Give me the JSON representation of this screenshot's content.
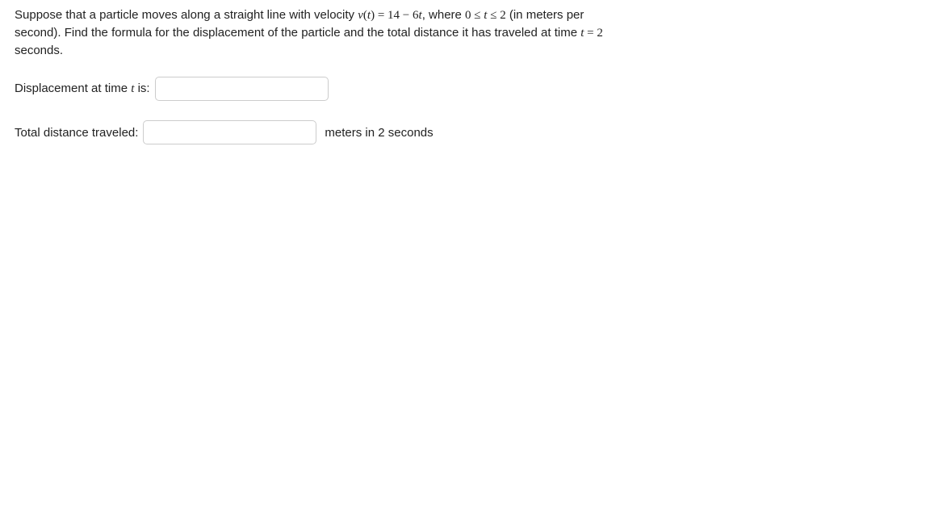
{
  "problem": {
    "text_before_velocity": "Suppose that a particle moves along a straight line with velocity ",
    "velocity_fn": "v",
    "velocity_arg_open": "(",
    "velocity_var": "t",
    "velocity_arg_close": ")",
    "equals": " = ",
    "velocity_expr_a": "14",
    "velocity_expr_minus": " − ",
    "velocity_expr_b": "6",
    "velocity_expr_var": "t",
    "text_where": ", where ",
    "range_lower": "0",
    "range_le1": " ≤ ",
    "range_var": "t",
    "range_le2": " ≤ ",
    "range_upper": "2",
    "text_units": " (in meters per second). Find the formula for the displacement of the particle and the total distance it has traveled at time ",
    "time_var": "t",
    "time_eq": " = ",
    "time_val": "2",
    "time_suffix": " seconds."
  },
  "answers": {
    "displacement": {
      "label_before_var": "Displacement at time ",
      "label_var": "t",
      "label_after_var": " is:",
      "value": "",
      "suffix": ""
    },
    "distance": {
      "label": "Total distance traveled:",
      "value": "",
      "suffix": "meters in 2 seconds"
    }
  }
}
